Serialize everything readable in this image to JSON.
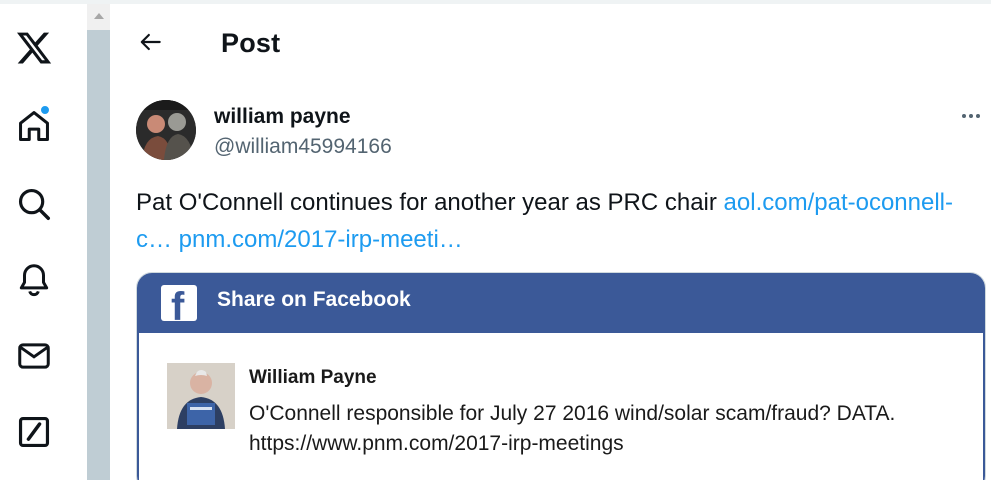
{
  "nav": {
    "items": [
      {
        "name": "x-logo",
        "icon": "x-logo-icon"
      },
      {
        "name": "home",
        "icon": "home-icon",
        "has_notification": true
      },
      {
        "name": "explore",
        "icon": "search-icon"
      },
      {
        "name": "notifications",
        "icon": "bell-icon"
      },
      {
        "name": "messages",
        "icon": "mail-icon"
      },
      {
        "name": "grok",
        "icon": "grok-icon"
      }
    ],
    "notification_color": "#1d9bf0"
  },
  "header": {
    "back_icon": "arrow-left-icon",
    "title": "Post"
  },
  "tweet": {
    "author_name": "william payne",
    "author_handle": "@william45994166",
    "text_before": "Pat O'Connell continues for another year as PRC chair ",
    "link1": "aol.com/pat-oconnell-c…",
    "link_sep": " ",
    "link2": "pnm.com/2017-irp-meeti…",
    "link_color": "#1d9bf0",
    "more_icon": "more-horizontal-icon"
  },
  "media": {
    "bar_title": "Share on Facebook",
    "bar_color": "#3b5998",
    "logo_letter": "f",
    "user_name": "William Payne",
    "message_line1": "O'Connell responsible for July 27 2016 wind/solar scam/fraud? DATA.",
    "message_line2": "https://www.pnm.com/2017-irp-meetings"
  }
}
